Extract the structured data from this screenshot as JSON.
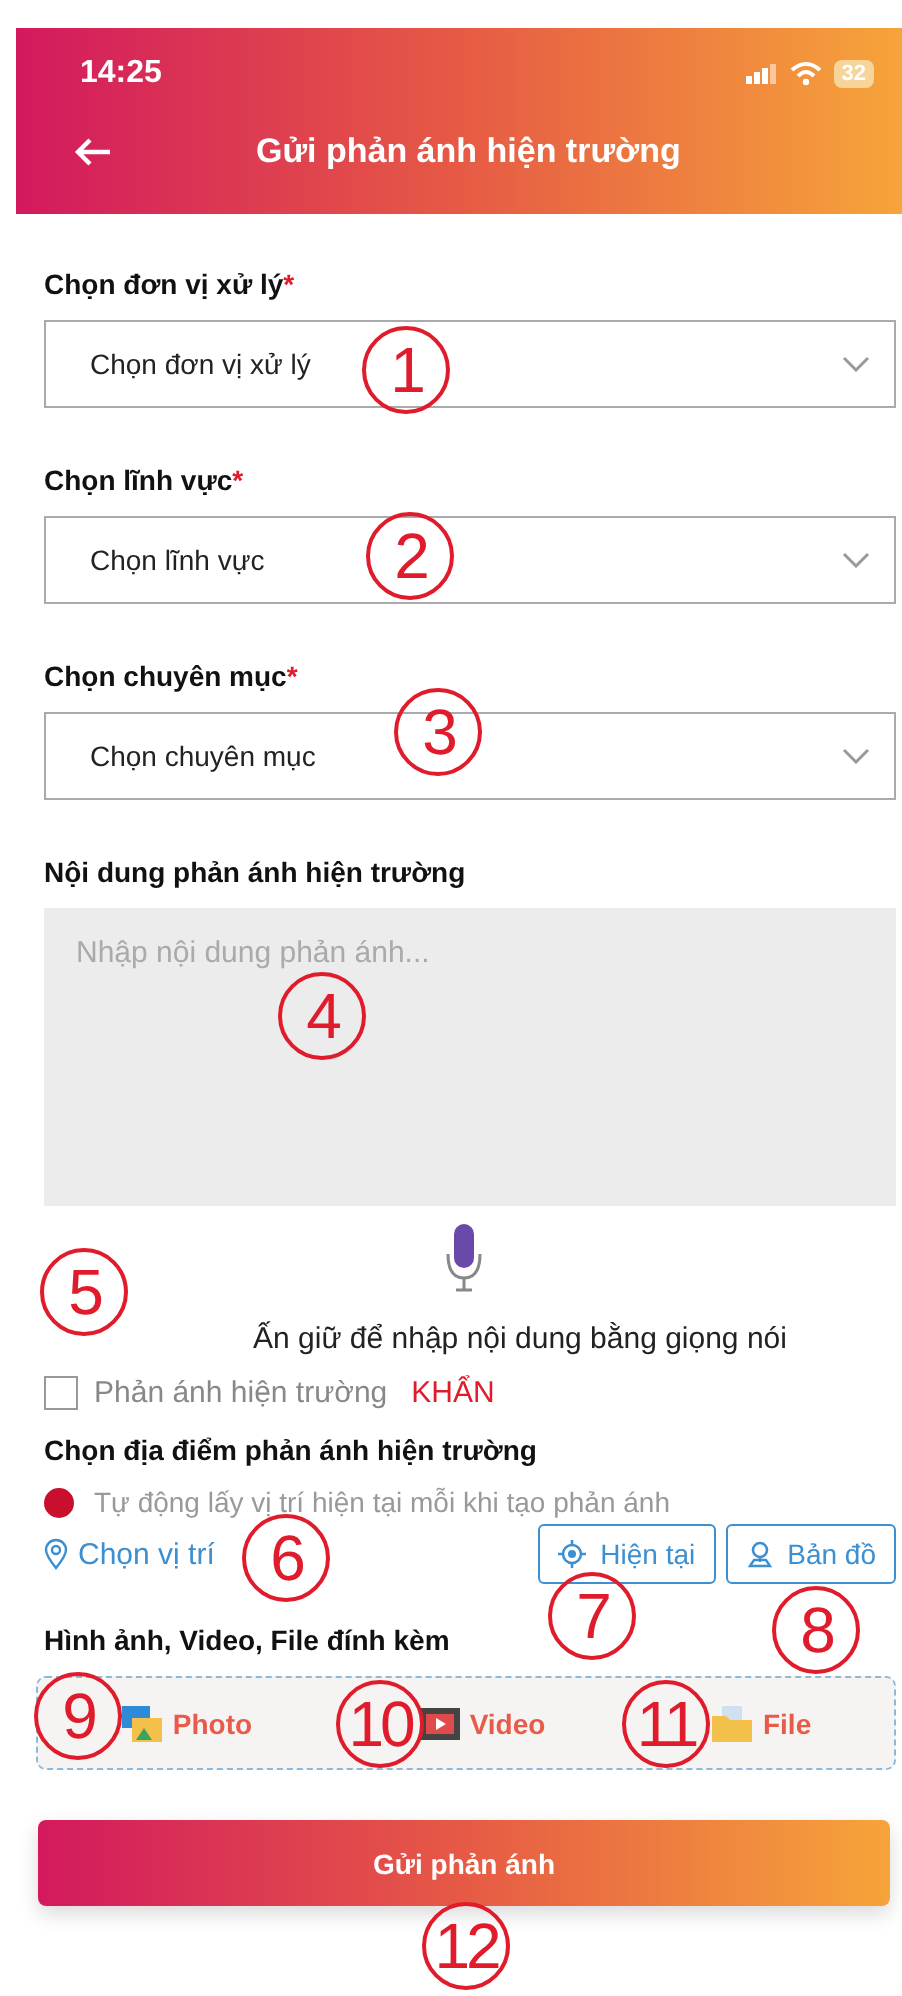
{
  "status_bar": {
    "time": "14:25",
    "battery": "32"
  },
  "header": {
    "title": "Gửi phản ánh hiện trường"
  },
  "selects": [
    {
      "label": "Chọn đơn vị xử lý",
      "required_mark": "*",
      "placeholder": "Chọn đơn vị xử lý"
    },
    {
      "label": "Chọn lĩnh vực",
      "required_mark": "*",
      "placeholder": "Chọn lĩnh vực"
    },
    {
      "label": "Chọn chuyên mục",
      "required_mark": "*",
      "placeholder": "Chọn chuyên mục"
    }
  ],
  "content": {
    "label": "Nội dung phản ánh hiện trường",
    "placeholder": "Nhập nội dung phản ánh..."
  },
  "voice_hint": "Ấn giữ để nhập nội dung bằng giọng nói",
  "urgent": {
    "label": "Phản ánh hiện trường",
    "tag": "KHẨN",
    "checked": false
  },
  "location": {
    "label": "Chọn địa điểm phản ánh hiện trường",
    "auto_text": "Tự động lấy vị trí hiện tại mỗi khi tạo phản ánh",
    "auto_selected": true,
    "choose_link": "Chọn vị trí",
    "buttons": [
      "Hiện tại",
      "Bản đồ"
    ]
  },
  "attachments": {
    "label": "Hình ảnh, Video, File đính kèm",
    "items": [
      {
        "kind": "photo",
        "label": "Photo"
      },
      {
        "kind": "video",
        "label": "Video"
      },
      {
        "kind": "file",
        "label": "File"
      }
    ]
  },
  "submit": "Gửi phản ánh",
  "annotations": [
    "1",
    "2",
    "3",
    "4",
    "5",
    "6",
    "7",
    "8",
    "9",
    "10",
    "11",
    "12"
  ]
}
